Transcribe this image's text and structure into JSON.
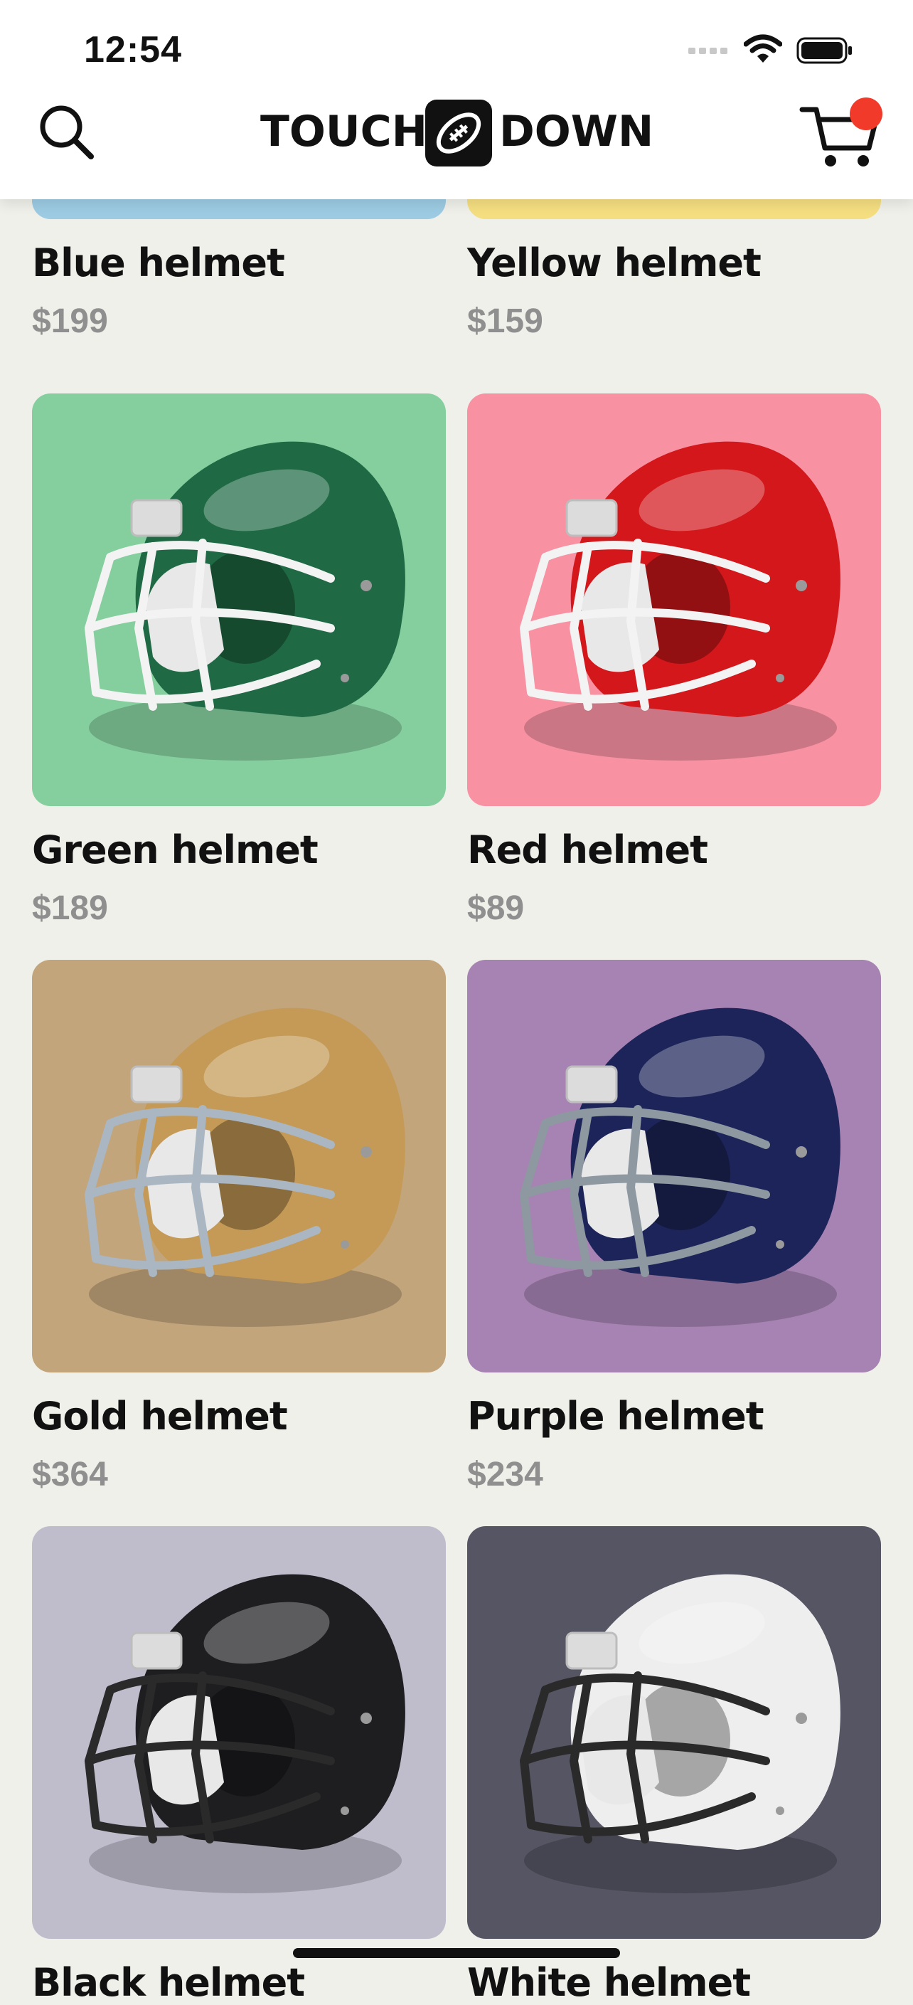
{
  "status_bar": {
    "time": "12:54"
  },
  "header": {
    "logo_left": "TOUCH",
    "logo_right": "DOWN",
    "search_icon": "search-icon",
    "cart_icon": "cart-icon"
  },
  "colors": {
    "background": "#f0f0ea",
    "badge": "#f23a2b",
    "price": "#8f8f8f"
  },
  "products": [
    {
      "name": "Blue helmet",
      "price": "$199",
      "bg": "#9ccbe3",
      "shell": "#3d7fb8",
      "mask": "#ffffff"
    },
    {
      "name": "Yellow helmet",
      "price": "$159",
      "bg": "#f5de80",
      "shell": "#e0b42b",
      "mask": "#ffffff"
    },
    {
      "name": "Green helmet",
      "price": "$189",
      "bg": "#85cf9e",
      "shell": "#1f6a44",
      "mask": "#f3f3f3"
    },
    {
      "name": "Red helmet",
      "price": "$89",
      "bg": "#f891a2",
      "shell": "#d3171b",
      "mask": "#f3f3f3"
    },
    {
      "name": "Gold helmet",
      "price": "$364",
      "bg": "#c3a57c",
      "shell": "#c49a56",
      "mask": "#aab6c2"
    },
    {
      "name": "Purple helmet",
      "price": "$234",
      "bg": "#a683b2",
      "shell": "#1d2459",
      "mask": "#8d98a1"
    },
    {
      "name": "Black helmet",
      "price": "",
      "bg": "#bfbdcc",
      "shell": "#1e1e20",
      "mask": "#2a2a2a"
    },
    {
      "name": "White helmet",
      "price": "",
      "bg": "#555563",
      "shell": "#eeeeee",
      "mask": "#2a2a2a"
    }
  ]
}
